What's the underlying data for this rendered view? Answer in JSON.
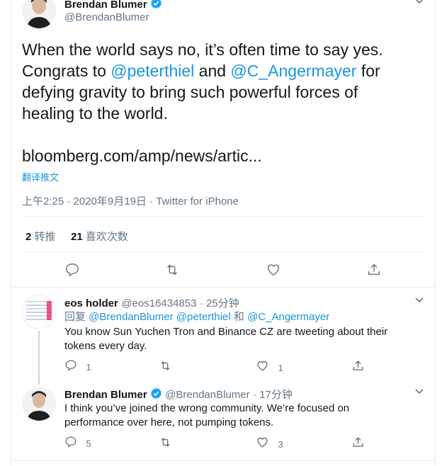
{
  "main": {
    "author_name": "Brendan Blumer",
    "author_handle": "@BrendanBlumer",
    "text_line1": "When the world says no, it’s often time to say yes.",
    "text_congrats": "Congrats to ",
    "mention1": "@peterthiel",
    "text_and": " and ",
    "mention2": "@C_Angermayer",
    "text_for": " for",
    "text_line3": "defying gravity to bring such powerful forces of",
    "text_line4": "healing to the world.",
    "link": "bloomberg.com/amp/news/artic...",
    "translate": "翻译推文",
    "timestamp": "上午2:25 · 2020年9月19日 · Twitter for iPhone",
    "retweets_count": "2",
    "retweets_label": "转推",
    "likes_count": "21",
    "likes_label": "喜欢次数"
  },
  "replies": [
    {
      "name": "eos holder",
      "handle": "@eos16434853",
      "time": "· 25分钟",
      "reply_to_prefix": "回复 ",
      "reply_to_m1": "@BrendanBlumer",
      "reply_to_m2": " @peterthiel",
      "reply_to_and": " 和 ",
      "reply_to_m3": "@C_Angermayer",
      "line1": "You know Sun Yuchen Tron and Binance CZ are tweeting about their",
      "line2": "tokens every day.",
      "reply_count": "1",
      "like_count": "1"
    },
    {
      "name": "Brendan Blumer",
      "handle": "@BrendanBlumer",
      "time": "· 17分钟",
      "line1": "I think you’ve joined the wrong community. We’re focused on",
      "line2": "performance over here, not pumping tokens.",
      "reply_count": "5",
      "like_count": "3"
    }
  ],
  "colors": {
    "accent": "#1da1f2",
    "link": "#1b95e0",
    "muted": "#657786",
    "border": "#e6ecf0"
  },
  "icons": [
    "reply-icon",
    "retweet-icon",
    "like-icon",
    "share-icon",
    "verified-icon",
    "chevron-down-icon"
  ]
}
